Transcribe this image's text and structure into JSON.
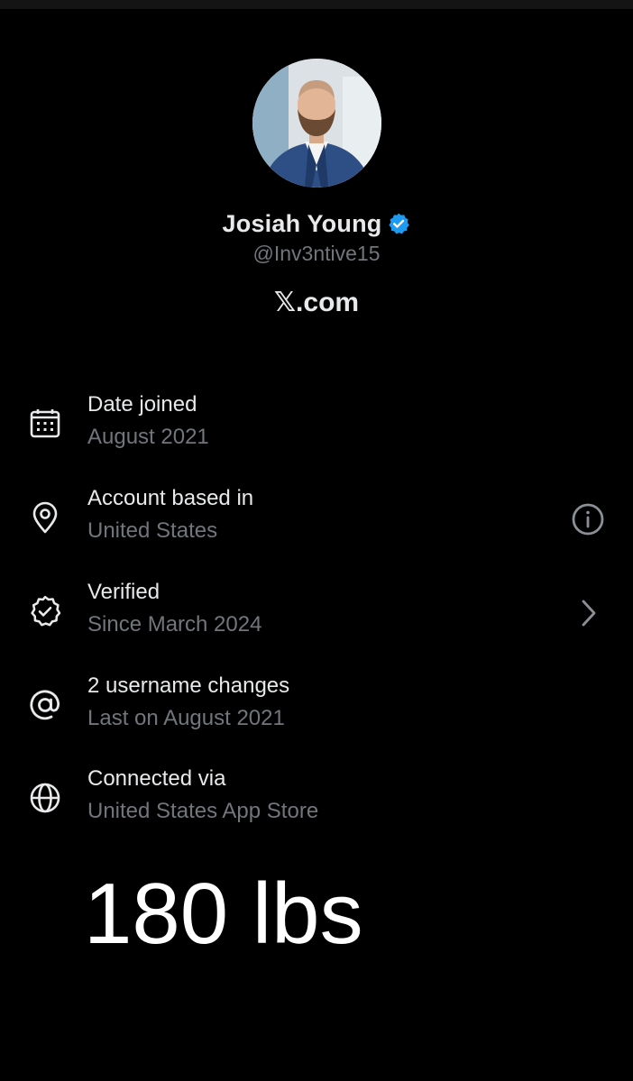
{
  "profile": {
    "display_name": "Josiah Young",
    "handle": "@Inv3ntive15",
    "site": "𝕏.com",
    "verified_color": "#1d9bf0"
  },
  "info_rows": [
    {
      "icon": "calendar-icon",
      "title": "Date joined",
      "subtitle": "August 2021"
    },
    {
      "icon": "location-pin-icon",
      "title": "Account based in",
      "subtitle": "United States",
      "action": "info-icon"
    },
    {
      "icon": "verified-badge-icon",
      "title": "Verified",
      "subtitle": "Since March 2024",
      "action": "chevron-right-icon"
    },
    {
      "icon": "at-sign-icon",
      "title": "2 username changes",
      "subtitle": "Last on August 2021"
    },
    {
      "icon": "globe-icon",
      "title": "Connected via",
      "subtitle": "United States App Store"
    }
  ],
  "overlay_text": "180 lbs",
  "colors": {
    "background": "#000000",
    "primary_text": "#e7e9ea",
    "secondary_text": "#71767b"
  }
}
